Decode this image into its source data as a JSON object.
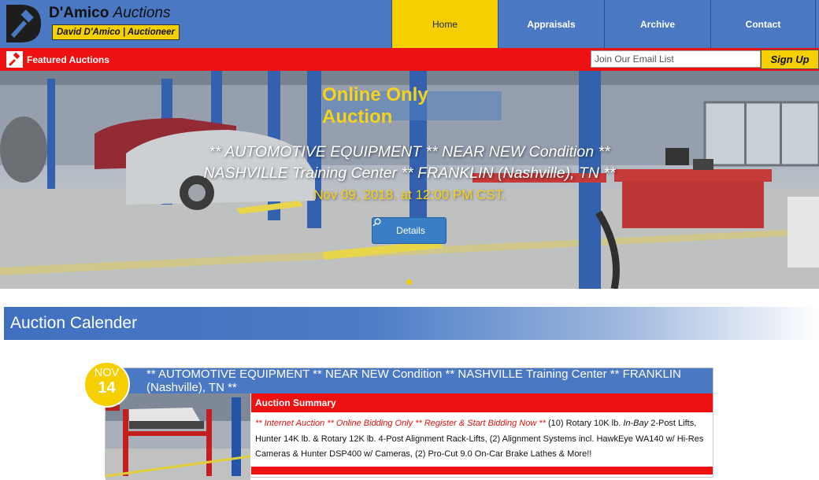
{
  "brand": {
    "name": "D'Amico",
    "name_suffix": "Auctions",
    "tagline": "David D'Amico | Auctioneer"
  },
  "nav": {
    "items": [
      {
        "label": "Home",
        "active": true
      },
      {
        "label": "Appraisals",
        "active": false
      },
      {
        "label": "Archive",
        "active": false
      },
      {
        "label": "Contact",
        "active": false
      }
    ]
  },
  "redbar": {
    "featured_label": "Featured Auctions",
    "email_placeholder": "Join Our Email List",
    "signup_label": "Sign Up"
  },
  "hero": {
    "badge": "Online Only Auction",
    "title_line1": "** AUTOMOTIVE EQUIPMENT ** NEAR NEW Condition **",
    "title_line2": "NASHVILLE Training Center ** FRANKLIN (Nashville), TN **",
    "date": "Nov 09, 2018. at 12:00 PM CST.",
    "details_label": "Details"
  },
  "calendar": {
    "heading": "Auction Calender",
    "auction": {
      "month": "NOV",
      "day": "14",
      "title": "** AUTOMOTIVE EQUIPMENT ** NEAR NEW Condition ** NASHVILLE Training Center ** FRANKLIN (Nashville), TN **",
      "summary_heading": "Auction Summary",
      "summary_highlight": "** Internet Auction ** Online Bidding Only ** Register & Start Bidding Now **",
      "summary_part1": " (10) Rotary 10K lb. ",
      "summary_italic": "In-Bay",
      "summary_part2": " 2-Post Lifts, Hunter 14K lb. & Rotary 12K lb. 4-Post Alignment Rack-Lifts, (2) Alignment Systems incl. HawkEye WA140 w/ Hi-Res Cameras & Hunter DSP400 w/ Cameras, (2) Pro-Cut 9.0 On-Car Brake Lathes & More!!"
    }
  },
  "colors": {
    "header_blue": "#4a78c2",
    "accent_yellow": "#f6cf00",
    "accent_red": "#ee1111"
  }
}
